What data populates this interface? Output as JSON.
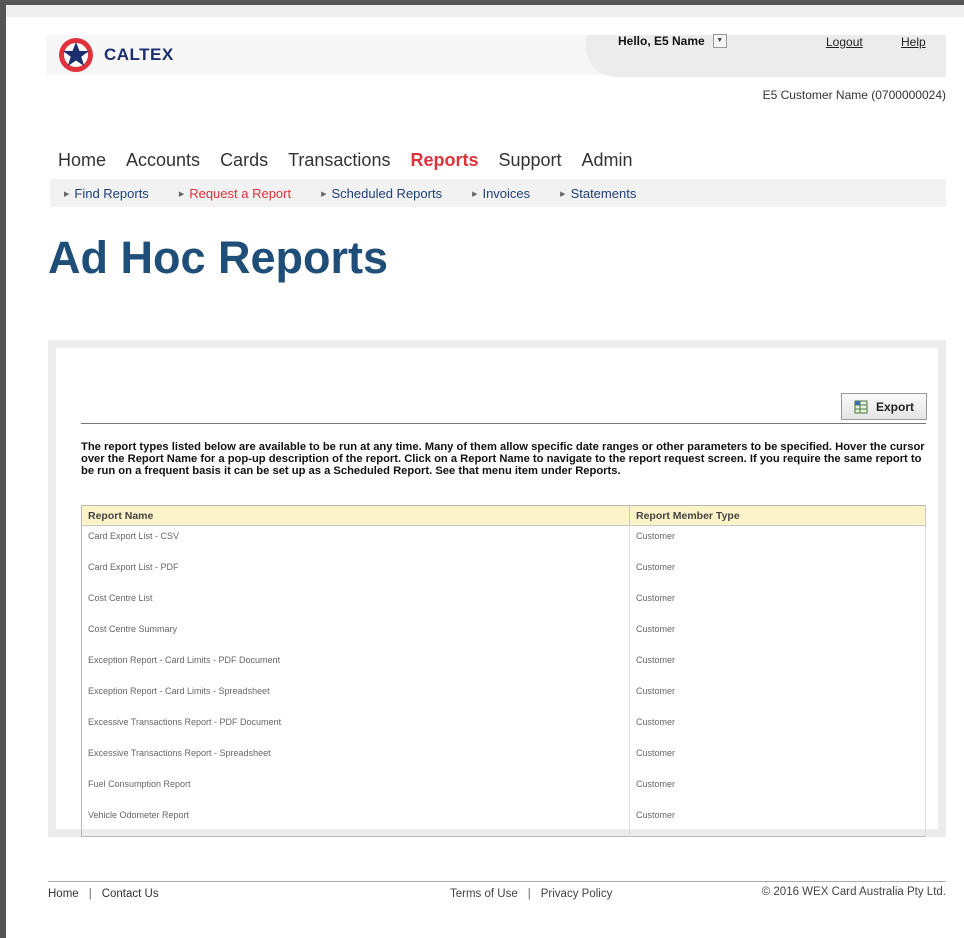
{
  "brand": {
    "name": "CALTEX",
    "colors": {
      "red": "#e0323c",
      "navy": "#1b2f6e",
      "title_blue": "#1f4e79"
    }
  },
  "header": {
    "greeting": "Hello, E5 Name",
    "logout": "Logout",
    "help": "Help",
    "customer": "E5 Customer Name (0700000024)"
  },
  "nav": {
    "main": [
      "Home",
      "Accounts",
      "Cards",
      "Transactions",
      "Reports",
      "Support",
      "Admin"
    ],
    "active": "Reports",
    "sub": [
      "Find Reports",
      "Request a Report",
      "Scheduled Reports",
      "Invoices",
      "Statements"
    ],
    "sub_active": "Request a Report"
  },
  "page": {
    "title": "Ad Hoc Reports"
  },
  "panel": {
    "export_label": "Export",
    "intro": "The report types listed below are available to be run at any time. Many of them allow specific date ranges or other parameters to be specified. Hover the cursor over the Report Name for a pop-up description of the report. Click on a Report Name to navigate to the report request screen. If you require the same report to be run on a frequent basis it can be set up as a Scheduled Report. See that menu item under Reports."
  },
  "table": {
    "columns": [
      "Report Name",
      "Report Member Type"
    ],
    "rows": [
      [
        "Card Export List - CSV",
        "Customer"
      ],
      [
        "Card Export List - PDF",
        "Customer"
      ],
      [
        "Cost Centre List",
        "Customer"
      ],
      [
        "Cost Centre Summary",
        "Customer"
      ],
      [
        "Exception Report - Card Limits - PDF Document",
        "Customer"
      ],
      [
        "Exception Report - Card Limits - Spreadsheet",
        "Customer"
      ],
      [
        "Excessive Transactions Report - PDF Document",
        "Customer"
      ],
      [
        "Excessive Transactions Report - Spreadsheet",
        "Customer"
      ],
      [
        "Fuel Consumption Report",
        "Customer"
      ],
      [
        "Vehicle Odometer Report",
        "Customer"
      ]
    ]
  },
  "footer": {
    "home": "Home",
    "contact": "Contact Us",
    "terms": "Terms of Use",
    "privacy": "Privacy Policy",
    "copyright": "© 2016 WEX Card Australia Pty Ltd."
  }
}
